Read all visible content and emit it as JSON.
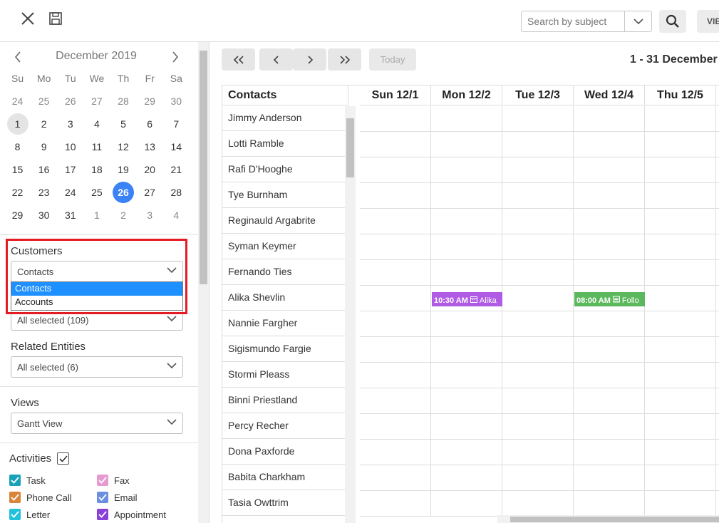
{
  "toolbar": {
    "close_icon": "close-icon",
    "save_icon": "save-icon",
    "search_placeholder": "Search by subject",
    "view_label": "VIEW"
  },
  "calendar": {
    "title": "December 2019",
    "weekdays": [
      "Su",
      "Mo",
      "Tu",
      "We",
      "Th",
      "Fr",
      "Sa"
    ],
    "weeks": [
      [
        "24",
        "25",
        "26",
        "27",
        "28",
        "29",
        "30"
      ],
      [
        "1",
        "2",
        "3",
        "4",
        "5",
        "6",
        "7"
      ],
      [
        "8",
        "9",
        "10",
        "11",
        "12",
        "13",
        "14"
      ],
      [
        "15",
        "16",
        "17",
        "18",
        "19",
        "20",
        "21"
      ],
      [
        "22",
        "23",
        "24",
        "25",
        "26",
        "27",
        "28"
      ],
      [
        "29",
        "30",
        "31",
        "1",
        "2",
        "3",
        "4"
      ]
    ],
    "today": "1",
    "selected": "26"
  },
  "filters": {
    "customers_label": "Customers",
    "customers_value": "Contacts",
    "customers_options": [
      "Contacts",
      "Accounts"
    ],
    "owners_value": "All selected (109)",
    "related_label": "Related Entities",
    "related_value": "All selected (6)",
    "views_label": "Views",
    "views_value": "Gantt View",
    "activities_label": "Activities",
    "activities": [
      {
        "label": "Task",
        "color": "#17a2b8"
      },
      {
        "label": "Fax",
        "color": "#e59ad0"
      },
      {
        "label": "Phone Call",
        "color": "#d9843a"
      },
      {
        "label": "Email",
        "color": "#6b8fe0"
      },
      {
        "label": "Letter",
        "color": "#23c0d9"
      },
      {
        "label": "Appointment",
        "color": "#8a3fd9"
      }
    ]
  },
  "schedule": {
    "today_label": "Today",
    "range_label": "1 - 31 December",
    "contacts_header": "Contacts",
    "days": [
      "Sun 12/1",
      "Mon 12/2",
      "Tue 12/3",
      "Wed 12/4",
      "Thu 12/5"
    ],
    "contacts": [
      "Jimmy Anderson",
      "Lotti Ramble",
      "Rafi D'Hooghe",
      "Tye Burnham",
      "Reginauld Argabrite",
      "Syman Keymer",
      "Fernando Ties",
      "Alika Shevlin",
      "Nannie Fargher",
      "Sigismundo Fargie",
      "Stormi Pleass",
      "Binni Priestland",
      "Percy Recher",
      "Dona Paxforde",
      "Babita Charkham",
      "Tasia Owttrim"
    ],
    "events": [
      {
        "time": "10:30 AM",
        "text": "Alika",
        "color": "#b05be5"
      },
      {
        "time": "08:00 AM",
        "text": "Follo",
        "color": "#5cb85c"
      }
    ]
  }
}
